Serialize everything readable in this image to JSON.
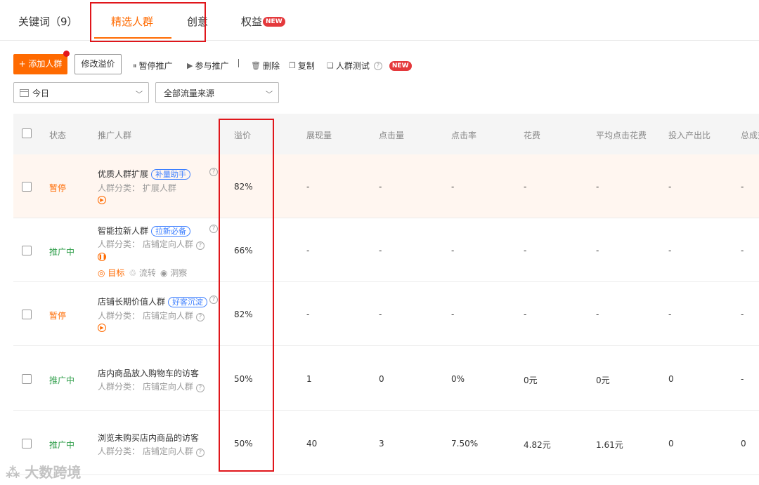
{
  "tabs": [
    {
      "label": "关键词（9）"
    },
    {
      "label": "精选人群"
    },
    {
      "label": "创意"
    },
    {
      "label": "权益",
      "badge": "NEW"
    }
  ],
  "toolbar": {
    "add_label": "+ 添加人群",
    "modify_label": "修改溢价",
    "pause_label": "暂停推广",
    "join_label": "参与推广",
    "delete_label": "删除",
    "copy_label": "复制",
    "test_label": "人群测试",
    "test_badge": "NEW"
  },
  "filters": {
    "date": "今日",
    "source": "全部流量来源"
  },
  "columns": [
    "状态",
    "推广人群",
    "溢价",
    "展现量",
    "点击量",
    "点击率",
    "花费",
    "平均点击花费",
    "投入产出比",
    "总成交"
  ],
  "rows": [
    {
      "status": "暂停",
      "name": "优质人群扩展",
      "tag": "补量助手",
      "category": "人群分类： 扩展人群",
      "premium": "82%",
      "impressions": "-",
      "clicks": "-",
      "ctr": "-",
      "cost": "-",
      "cpc": "-",
      "roi": "-",
      "total": "-"
    },
    {
      "status": "推广中",
      "name": "智能拉新人群",
      "tag": "拉新必备",
      "category": "人群分类： 店铺定向人群",
      "premium": "66%",
      "action_target": "目标",
      "action_flow": "流转",
      "action_insight": "洞察",
      "impressions": "-",
      "clicks": "-",
      "ctr": "-",
      "cost": "-",
      "cpc": "-",
      "roi": "-",
      "total": "-"
    },
    {
      "status": "暂停",
      "name": "店铺长期价值人群",
      "tag": "好客沉淀",
      "category": "人群分类： 店铺定向人群",
      "premium": "82%",
      "impressions": "-",
      "clicks": "-",
      "ctr": "-",
      "cost": "-",
      "cpc": "-",
      "roi": "-",
      "total": "-"
    },
    {
      "status": "推广中",
      "name": "店内商品放入购物车的访客",
      "category": "人群分类： 店铺定向人群",
      "premium": "50%",
      "impressions": "1",
      "clicks": "0",
      "ctr": "0%",
      "cost": "0元",
      "cpc": "0元",
      "roi": "0",
      "total": "-"
    },
    {
      "status": "推广中",
      "name": "浏览未购买店内商品的访客",
      "category": "人群分类： 店铺定向人群",
      "premium": "50%",
      "impressions": "40",
      "clicks": "3",
      "ctr": "7.50%",
      "cost": "4.82元",
      "cpc": "1.61元",
      "roi": "0",
      "total": "0"
    }
  ],
  "watermark": "大数跨境",
  "colors": {
    "accent": "#ff6a00",
    "active_status": "#2f9e4a",
    "highlight_box": "#e0161b",
    "tag_blue": "#3d7fff"
  }
}
